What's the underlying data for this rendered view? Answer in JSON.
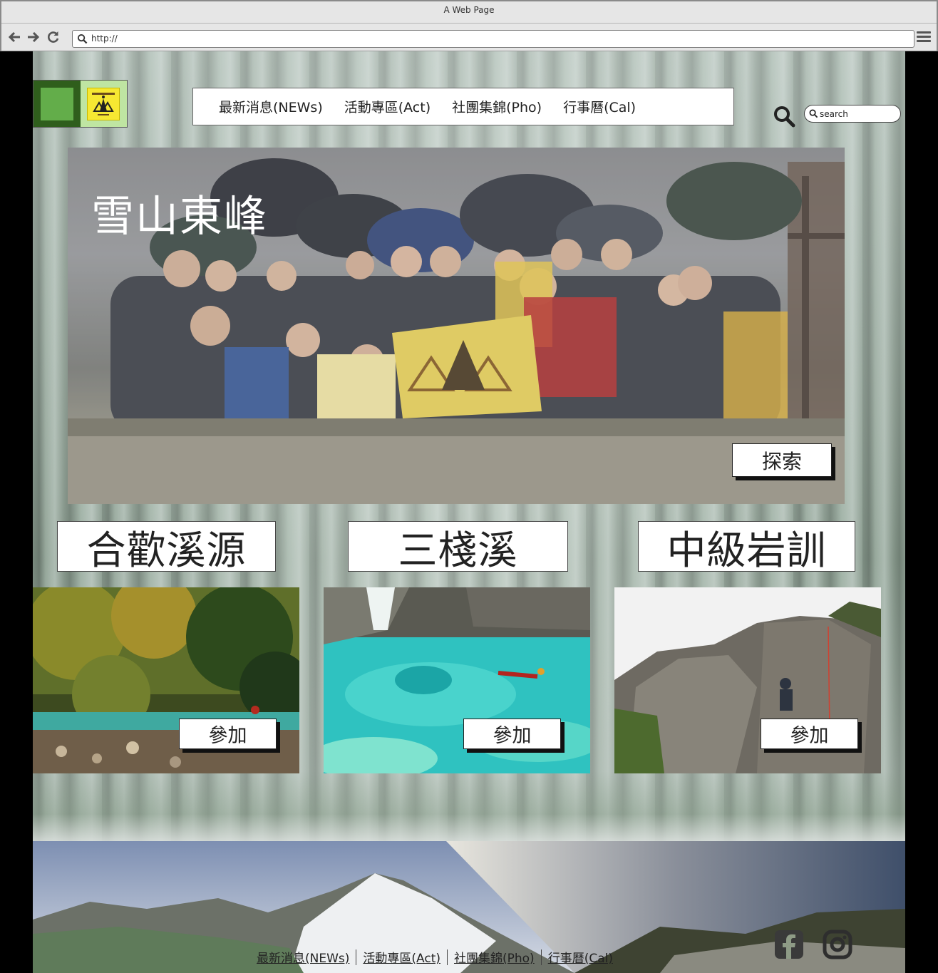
{
  "browser": {
    "window_title": "A Web Page",
    "url": "http://",
    "back_icon": "arrow-left-icon",
    "forward_icon": "arrow-right-icon",
    "reload_icon": "reload-icon",
    "menu_icon": "hamburger-icon"
  },
  "header": {
    "logo_icon": "club-logo",
    "nav": [
      "最新消息(NEWs)",
      "活動專區(Act)",
      "社團集錦(Pho)",
      "行事曆(Cal)"
    ],
    "search": {
      "placeholder": "search",
      "icon": "search-icon"
    }
  },
  "hero": {
    "title": "雪山東峰",
    "button": "探索"
  },
  "activities": [
    {
      "title": "合歡溪源",
      "button": "參加"
    },
    {
      "title": "三棧溪",
      "button": "參加"
    },
    {
      "title": "中級岩訓",
      "button": "參加"
    }
  ],
  "footer": {
    "links": [
      "最新消息(NEWs)",
      "活動專區(Act)",
      "社團集錦(Pho)",
      "行事曆(Cal)"
    ],
    "social": [
      "facebook-icon",
      "instagram-icon"
    ]
  },
  "colors": {
    "logo_dark": "#2f5e1c",
    "logo_mid": "#63ad4a",
    "logo_light": "#bfe5a2",
    "badge_yellow": "#f6e832"
  }
}
